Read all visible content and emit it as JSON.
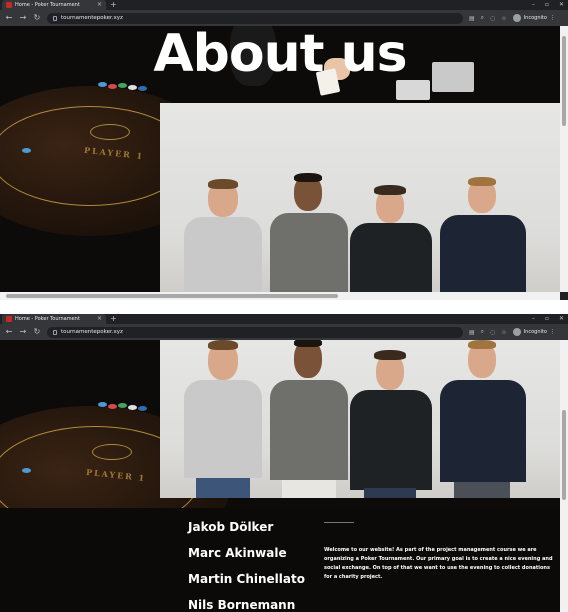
{
  "browser": {
    "tab_title": "Home - Poker Tournament",
    "tab_close": "×",
    "new_tab": "+",
    "url": "tournamentepoker.xyz",
    "profile_label": "Incognito",
    "controls": {
      "minimize": "–",
      "restore": "▫",
      "close": "✕"
    }
  },
  "hero": {
    "title": "About us",
    "table_text": "PLAYER 1"
  },
  "team": {
    "members": [
      "Jakob Dölker",
      "Marc Akinwale",
      "Martin Chinellato",
      "Nils Bornemann"
    ]
  },
  "intro": {
    "text": "Welcome to our website! As part of the project management course we are organizing a Poker Tournament. Our primary goal is to create a nice evening and social exchange. On top of that we want to use the evening to collect donations for a charity project."
  },
  "colors": {
    "page_background": "#0d0b0a",
    "accent_gold": "#b08a3a",
    "text": "#ffffff"
  }
}
